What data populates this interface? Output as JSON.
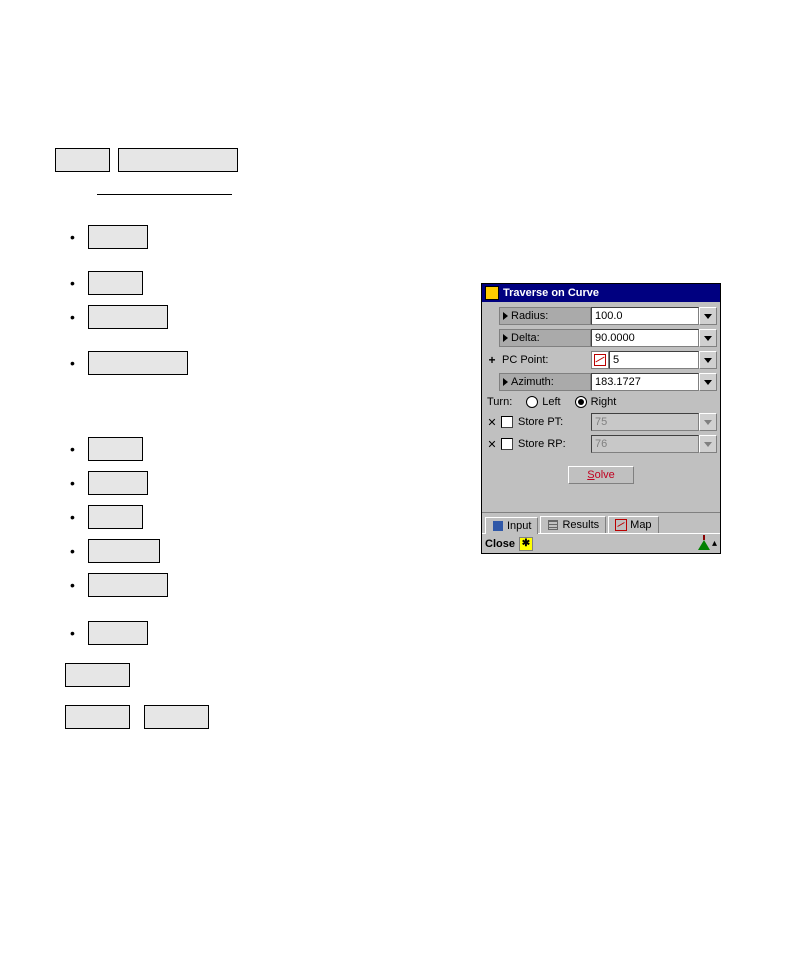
{
  "doc": {},
  "dialog": {
    "title": "Traverse on Curve",
    "rows": {
      "radius": {
        "label": "Radius:",
        "value": "100.0"
      },
      "delta": {
        "label": "Delta:",
        "value": "90.0000"
      },
      "pcpoint": {
        "label": "PC Point:",
        "value": "5"
      },
      "azimuth": {
        "label": "Azimuth:",
        "value": "183.1727"
      },
      "turn_label": "Turn:",
      "turn_left": "Left",
      "turn_right": "Right",
      "store_pt": {
        "label": "Store PT:",
        "value": "75"
      },
      "store_rp": {
        "label": "Store RP:",
        "value": "76"
      }
    },
    "solve_u": "S",
    "solve_rest": "olve",
    "tabs": {
      "input": "Input",
      "results": "Results",
      "map": "Map"
    },
    "close": "Close"
  }
}
